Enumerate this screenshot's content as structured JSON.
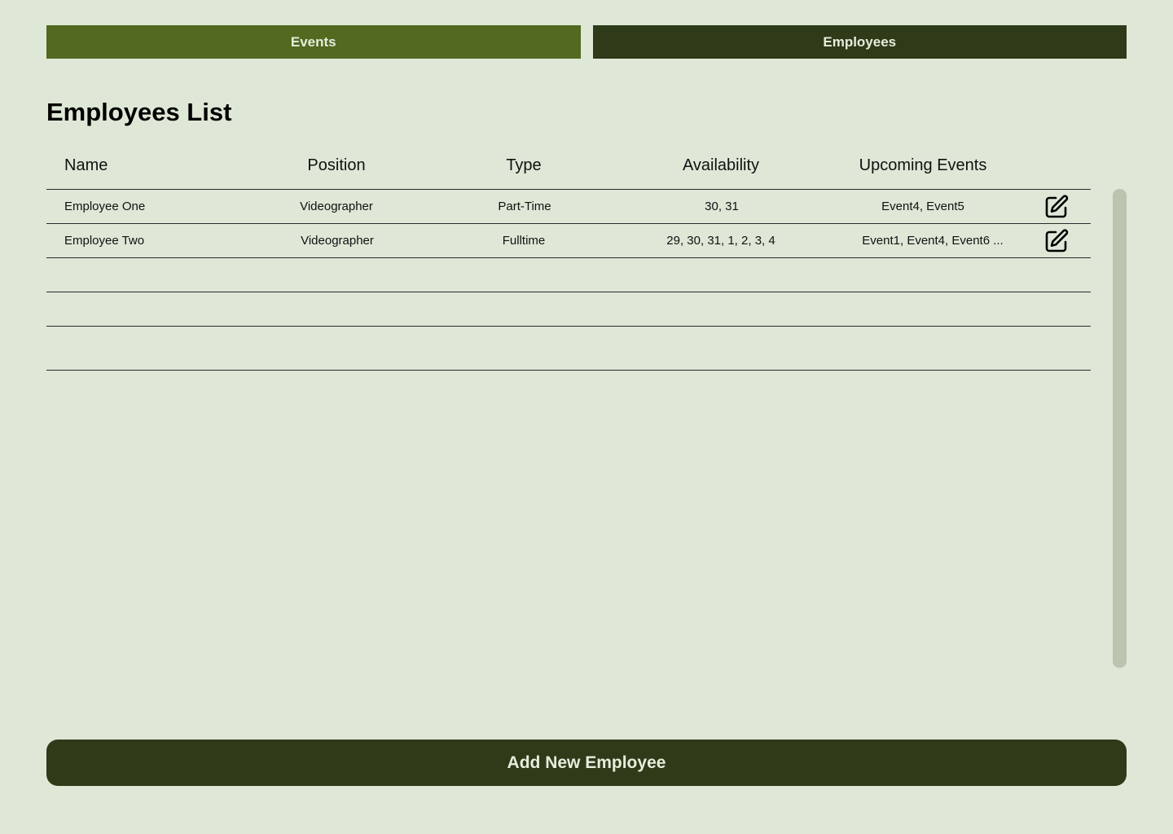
{
  "nav": {
    "tabs": [
      {
        "label": "Events",
        "color": "#52691f"
      },
      {
        "label": "Employees",
        "color": "#2e3a18"
      }
    ]
  },
  "page": {
    "title": "Employees List"
  },
  "table": {
    "headers": [
      "Name",
      "Position",
      "Type",
      "Availability",
      "Upcoming Events"
    ],
    "rows": [
      {
        "name": "Employee One",
        "position": "Videographer",
        "type": "Part-Time",
        "availability": "30, 31",
        "events": "Event4, Event5",
        "action_icon": "edit-icon"
      },
      {
        "name": "Employee Two",
        "position": "Videographer",
        "type": "Fulltime",
        "availability": "29, 30, 31, 1, 2, 3, 4",
        "events": "Event1, Event4, Event6 ...",
        "action_icon": "edit-icon"
      }
    ]
  },
  "actions": {
    "add_label": "Add New Employee"
  },
  "colors": {
    "background": "#dfe8d7",
    "accent_dark": "#2e3a18",
    "accent_light": "#52691f"
  }
}
